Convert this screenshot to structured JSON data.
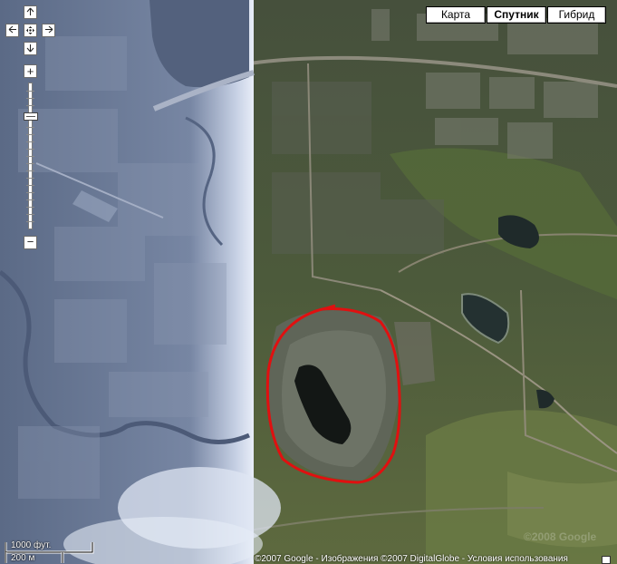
{
  "map_type": {
    "buttons": [
      {
        "label": "Карта",
        "active": false
      },
      {
        "label": "Спутник",
        "active": true
      },
      {
        "label": "Гибрид",
        "active": false
      }
    ]
  },
  "controls": {
    "pan_up_icon": "arrow-up-icon",
    "pan_left_icon": "arrow-left-icon",
    "pan_center_icon": "return-center-icon",
    "pan_right_icon": "arrow-right-icon",
    "pan_down_icon": "arrow-down-icon",
    "zoom_in_label": "+",
    "zoom_out_label": "−"
  },
  "scale": {
    "imperial": "1000 фут.",
    "metric": "200 м"
  },
  "copyright": {
    "google": "©2007 Google",
    "imagery": "Изображения ©2007 DigitalGlobe",
    "terms": "Условия использования",
    "separator": " - "
  },
  "watermark": "©2008 Google",
  "annotation": {
    "outline_color": "#e01010"
  }
}
